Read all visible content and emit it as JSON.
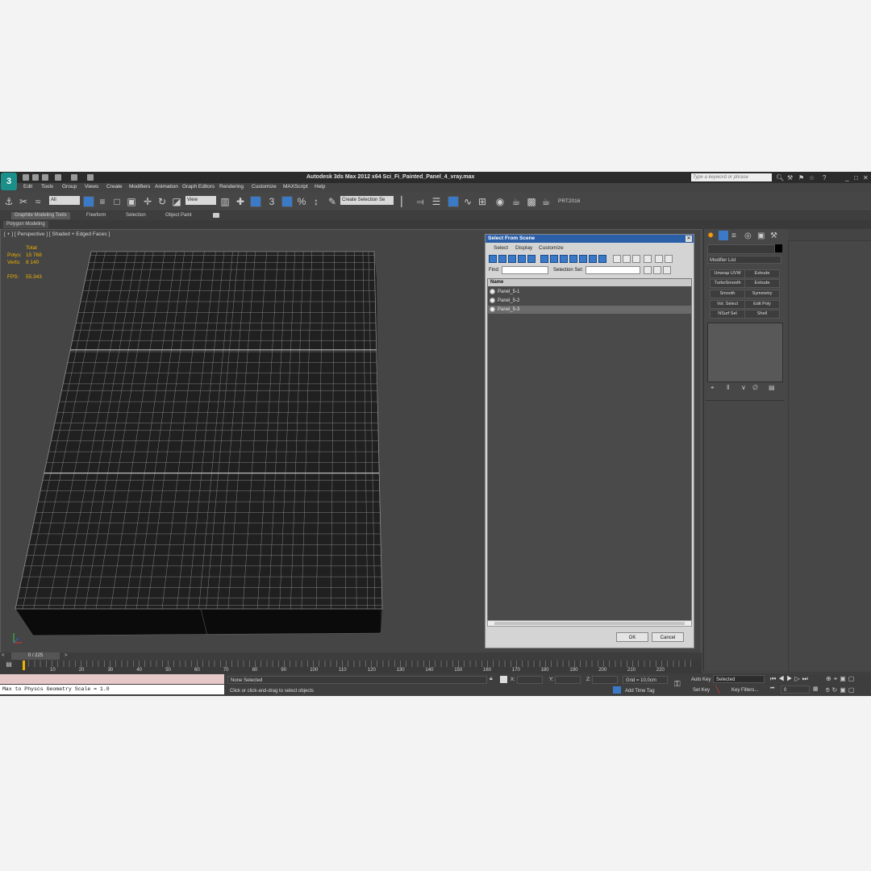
{
  "window": {
    "title": "Autodesk 3ds Max  2012 x64     Sci_Fi_Painted_Panel_4_vray.max",
    "search_placeholder": "Type a keyword or phrase",
    "logo": "3"
  },
  "menu": [
    "Edit",
    "Tools",
    "Group",
    "Views",
    "Create",
    "Modifiers",
    "Animation",
    "Graph Editors",
    "Rendering",
    "Customize",
    "MAXScript",
    "Help"
  ],
  "toolbar": {
    "selection_filter": "All",
    "reference_coord": "View",
    "named_selection": "Create Selection Se",
    "render_label": "PRT2016"
  },
  "ribbon": {
    "tabs": [
      "Graphite Modeling Tools",
      "Freeform",
      "Selection",
      "Object Paint"
    ],
    "sub_tab": "Polygon Modeling"
  },
  "viewport": {
    "label": "[ + ] [ Perspective ] [ Shaded + Edged Faces ]",
    "stats": {
      "total_label": "Total",
      "polys_label": "Polys:",
      "polys": "15 768",
      "verts_label": "Verts:",
      "verts": "8 140",
      "fps_label": "FPS:",
      "fps": "55.343"
    }
  },
  "dialog": {
    "title": "Select From Scene",
    "menus": [
      "Select",
      "Display",
      "Customize"
    ],
    "find_label": "Find:",
    "selection_set_label": "Selection Set:",
    "column_name": "Name",
    "items": [
      "Panel_5-1",
      "Panel_5-2",
      "Panel_5-3"
    ],
    "ok": "OK",
    "cancel": "Cancel"
  },
  "command_panel": {
    "modifier_list": "Modifier List",
    "buttons": [
      "Unwrap UVW",
      "Extrude",
      "TurboSmooth",
      "Extrude",
      "Smooth",
      "Symmetry",
      "Vol. Select",
      "Edit Poly",
      "NSurf Sel",
      "Shell"
    ]
  },
  "timeline": {
    "frame": "0 / 225",
    "ticks": [
      "10",
      "20",
      "30",
      "40",
      "50",
      "60",
      "70",
      "80",
      "90",
      "100",
      "110",
      "120",
      "130",
      "140",
      "150",
      "160",
      "170",
      "180",
      "190",
      "200",
      "210",
      "220"
    ]
  },
  "status": {
    "maxscript_output": "Max to Physcs Geometry Scale = 1.0",
    "selection": "None Selected",
    "prompt": "Click or click-and-drag to select objects",
    "x_label": "X:",
    "y_label": "Y:",
    "z_label": "Z:",
    "grid": "Grid = 10,0cm",
    "add_time_tag": "Add Time Tag",
    "auto_key": "Auto Key",
    "auto_key_mode": "Selected",
    "set_key": "Set Key",
    "key_filters": "Key Filters...",
    "current_frame": "0"
  }
}
